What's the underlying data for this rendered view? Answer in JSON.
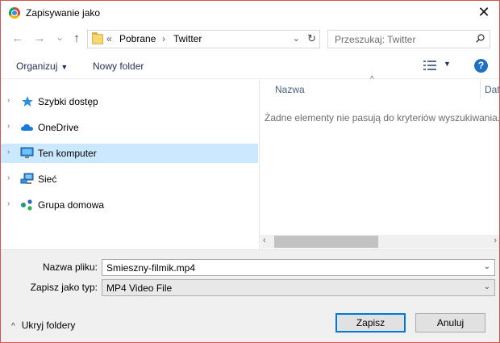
{
  "window": {
    "title": "Zapisywanie jako",
    "close_glyph": "✕",
    "app_icon": "chrome-icon"
  },
  "nav": {
    "back_glyph": "←",
    "forward_glyph": "→",
    "recent_glyph": "⌄",
    "up_glyph": "↑",
    "breadcrumb_overflow": "«",
    "breadcrumbs": [
      "Pobrane",
      "Twitter"
    ],
    "breadcrumb_sep": "›",
    "address_dropdown_glyph": "⌄",
    "refresh_glyph": "↻",
    "search_placeholder": "Przeszukaj: Twitter"
  },
  "toolbar": {
    "organize_label": "Organizuj",
    "organize_caret": "▼",
    "new_folder_label": "Nowy folder",
    "view_caret": "▼",
    "help_glyph": "?"
  },
  "tree": {
    "items": [
      {
        "label": "Szybki dostęp",
        "icon": "star-icon",
        "selected": false
      },
      {
        "label": "OneDrive",
        "icon": "cloud-icon",
        "selected": false
      },
      {
        "label": "Ten komputer",
        "icon": "computer-icon",
        "selected": true
      },
      {
        "label": "Sieć",
        "icon": "network-icon",
        "selected": false
      },
      {
        "label": "Grupa domowa",
        "icon": "homegroup-icon",
        "selected": false
      }
    ],
    "chevron_glyph": "›"
  },
  "files": {
    "col_name": "Nazwa",
    "col_date": "Dat",
    "sort_glyph": "^",
    "empty_message": "Żadne elementy nie pasują do kryteriów wyszukiwania.",
    "scroll_left_glyph": "‹",
    "scroll_right_glyph": "›"
  },
  "form": {
    "filename_label": "Nazwa pliku:",
    "filename_value": "Smieszny-filmik.mp4",
    "filetype_label": "Zapisz jako typ:",
    "filetype_value": "MP4 Video File",
    "combo_arrow": "⌄"
  },
  "footer": {
    "hide_folders_caret": "^",
    "hide_folders_label": "Ukryj foldery",
    "save_label": "Zapisz",
    "cancel_label": "Anuluj"
  },
  "colors": {
    "selection": "#cce8ff",
    "accent": "#0078d7",
    "help": "#1f6fc5",
    "window_border": "#d9534f"
  }
}
